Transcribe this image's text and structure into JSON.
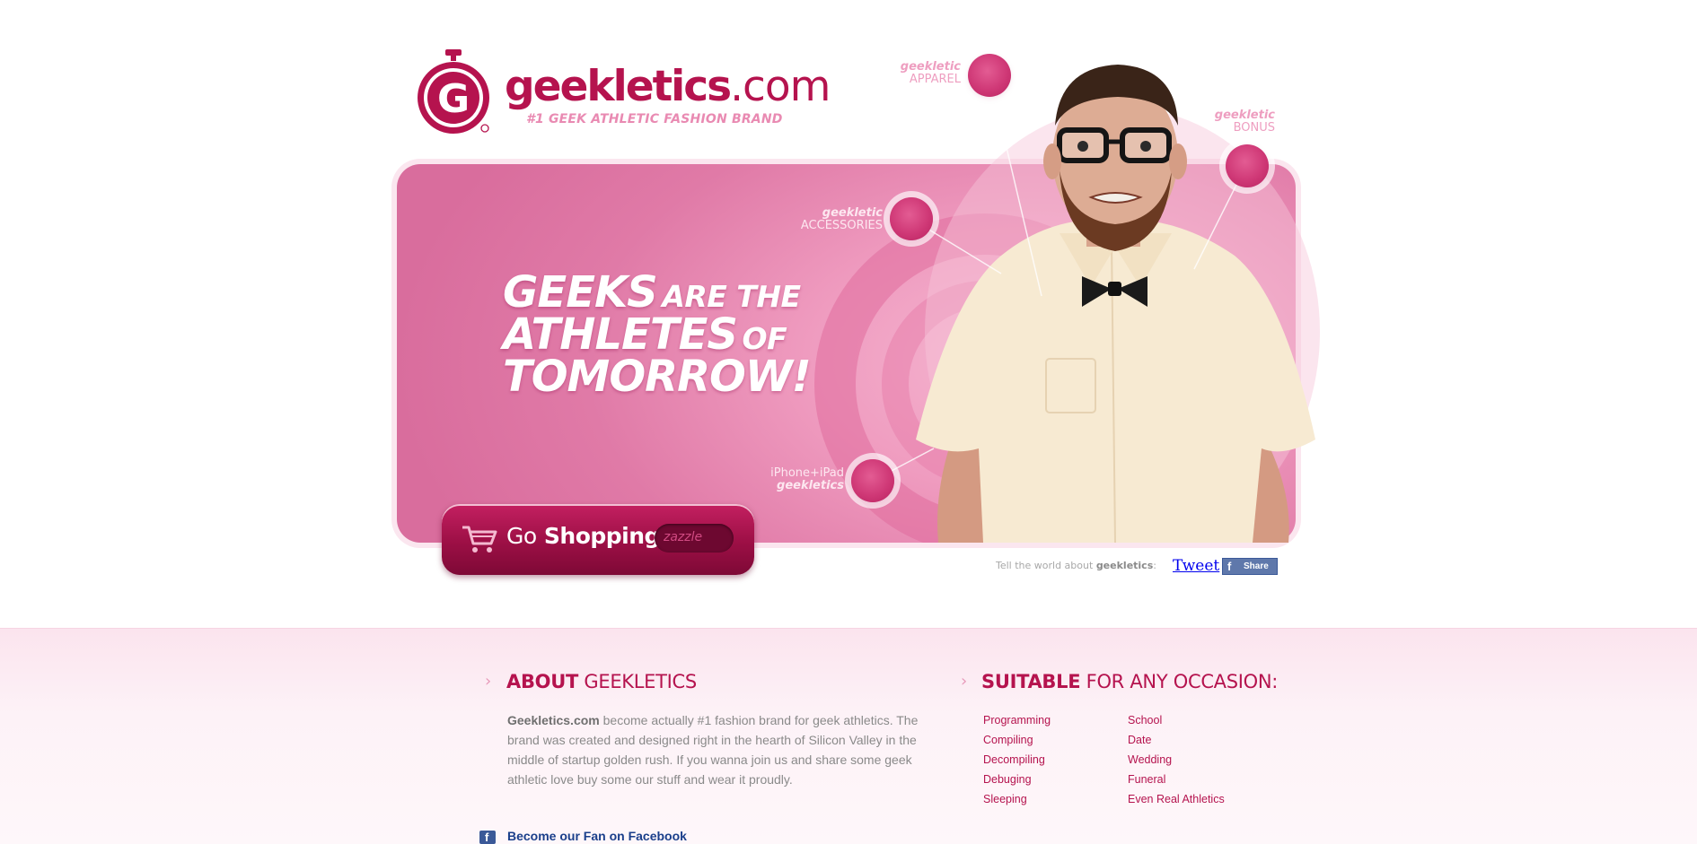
{
  "brand": {
    "name": "geekletics",
    "tld": ".com",
    "tagline": "#1 GEEK ATHLETIC FASHION BRAND",
    "logo_icon": "stopwatch-g-icon",
    "color_primary": "#b5134e",
    "color_accent": "#e98ab2"
  },
  "hero": {
    "headline_1": "GEEKS",
    "headline_2": "ARE THE",
    "headline_3": "ATHLETES",
    "headline_4": "OF",
    "headline_5": "TOMORROW!"
  },
  "categories": [
    {
      "line1": "geekletic",
      "line2": "APPAREL"
    },
    {
      "line1": "geekletic",
      "line2": "BONUS"
    },
    {
      "line1": "geekletic",
      "line2": "ACCESSORIES"
    },
    {
      "line1": "iPhone+iPad",
      "line2": "geekletics"
    }
  ],
  "shop_button": {
    "go": "Go",
    "label": "Shopping",
    "partner": "zazzle",
    "icon": "shopping-cart-icon"
  },
  "share": {
    "prompt": "Tell the world about",
    "brand": "geekletics",
    "colon": ":",
    "tweet": "Tweet",
    "fb_share": "Share"
  },
  "about": {
    "heading_bold": "ABOUT",
    "heading_rest": "GEEKLETICS",
    "body_brand": "Geekletics.com",
    "body_text": "become actually #1 fashion brand for geek athletics. The brand was created and designed right in the hearth of Silicon Valley in the middle of startup golden rush. If you wanna join us and share some geek athletic love buy some our stuff and wear it proudly."
  },
  "occasion": {
    "heading_bold": "SUITABLE",
    "heading_rest": "FOR ANY OCCASION:",
    "col1": [
      "Programming",
      "Compiling",
      "Decompiling",
      "Debuging",
      "Sleeping"
    ],
    "col2": [
      "School",
      "Date",
      "Wedding",
      "Funeral",
      "Even Real Athletics"
    ]
  },
  "facebook_fan": {
    "label": "Become our Fan on Facebook",
    "icon": "facebook-icon"
  }
}
